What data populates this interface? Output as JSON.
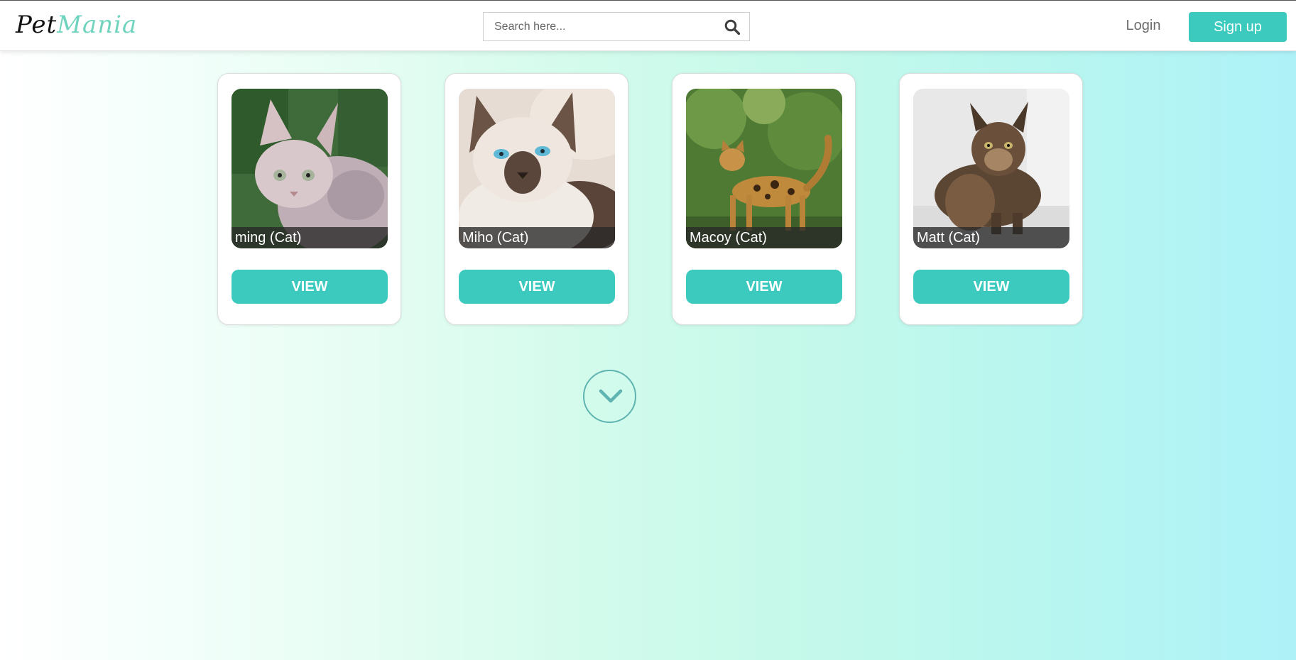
{
  "header": {
    "logo_part1": "Pet",
    "logo_part2": "Mania",
    "search_placeholder": "Search here...",
    "search_icon": "search-icon",
    "login_label": "Login",
    "signup_label": "Sign up"
  },
  "colors": {
    "accent": "#3bcabd",
    "logo_accent": "#6fd3bd",
    "caption_bg": "#282828",
    "chevron": "#5fb3b0"
  },
  "cards": [
    {
      "name": "ming (Cat)",
      "button": "VIEW"
    },
    {
      "name": "Miho (Cat)",
      "button": "VIEW"
    },
    {
      "name": "Macoy (Cat)",
      "button": "VIEW"
    },
    {
      "name": "Matt (Cat)",
      "button": "VIEW"
    }
  ],
  "more_icon": "chevron-down-icon"
}
